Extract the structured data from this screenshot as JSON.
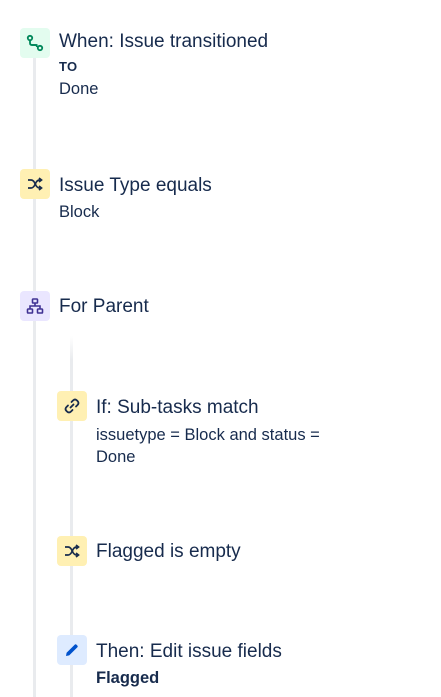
{
  "rule": {
    "trigger": {
      "title": "When: Issue transitioned",
      "to_label": "TO",
      "status": "Done",
      "icon": "transition-icon",
      "color": "#e3fcef"
    },
    "condition_issue_type": {
      "title": "Issue Type equals",
      "value": "Block",
      "icon": "shuffle-icon",
      "color": "#fff0b3"
    },
    "branch": {
      "title": "For Parent",
      "icon": "hierarchy-icon",
      "color": "#eae6ff"
    },
    "subtask_condition": {
      "title": "If: Sub-tasks match",
      "query_line1": "issuetype = Block and status =",
      "query_line2": "Done",
      "icon": "link-icon",
      "color": "#fff0b3"
    },
    "flag_condition": {
      "title": "Flagged is empty",
      "icon": "shuffle-icon",
      "color": "#fff0b3"
    },
    "action": {
      "title": "Then: Edit issue fields",
      "field": "Flagged",
      "icon": "pencil-icon",
      "color": "#deebff"
    }
  }
}
